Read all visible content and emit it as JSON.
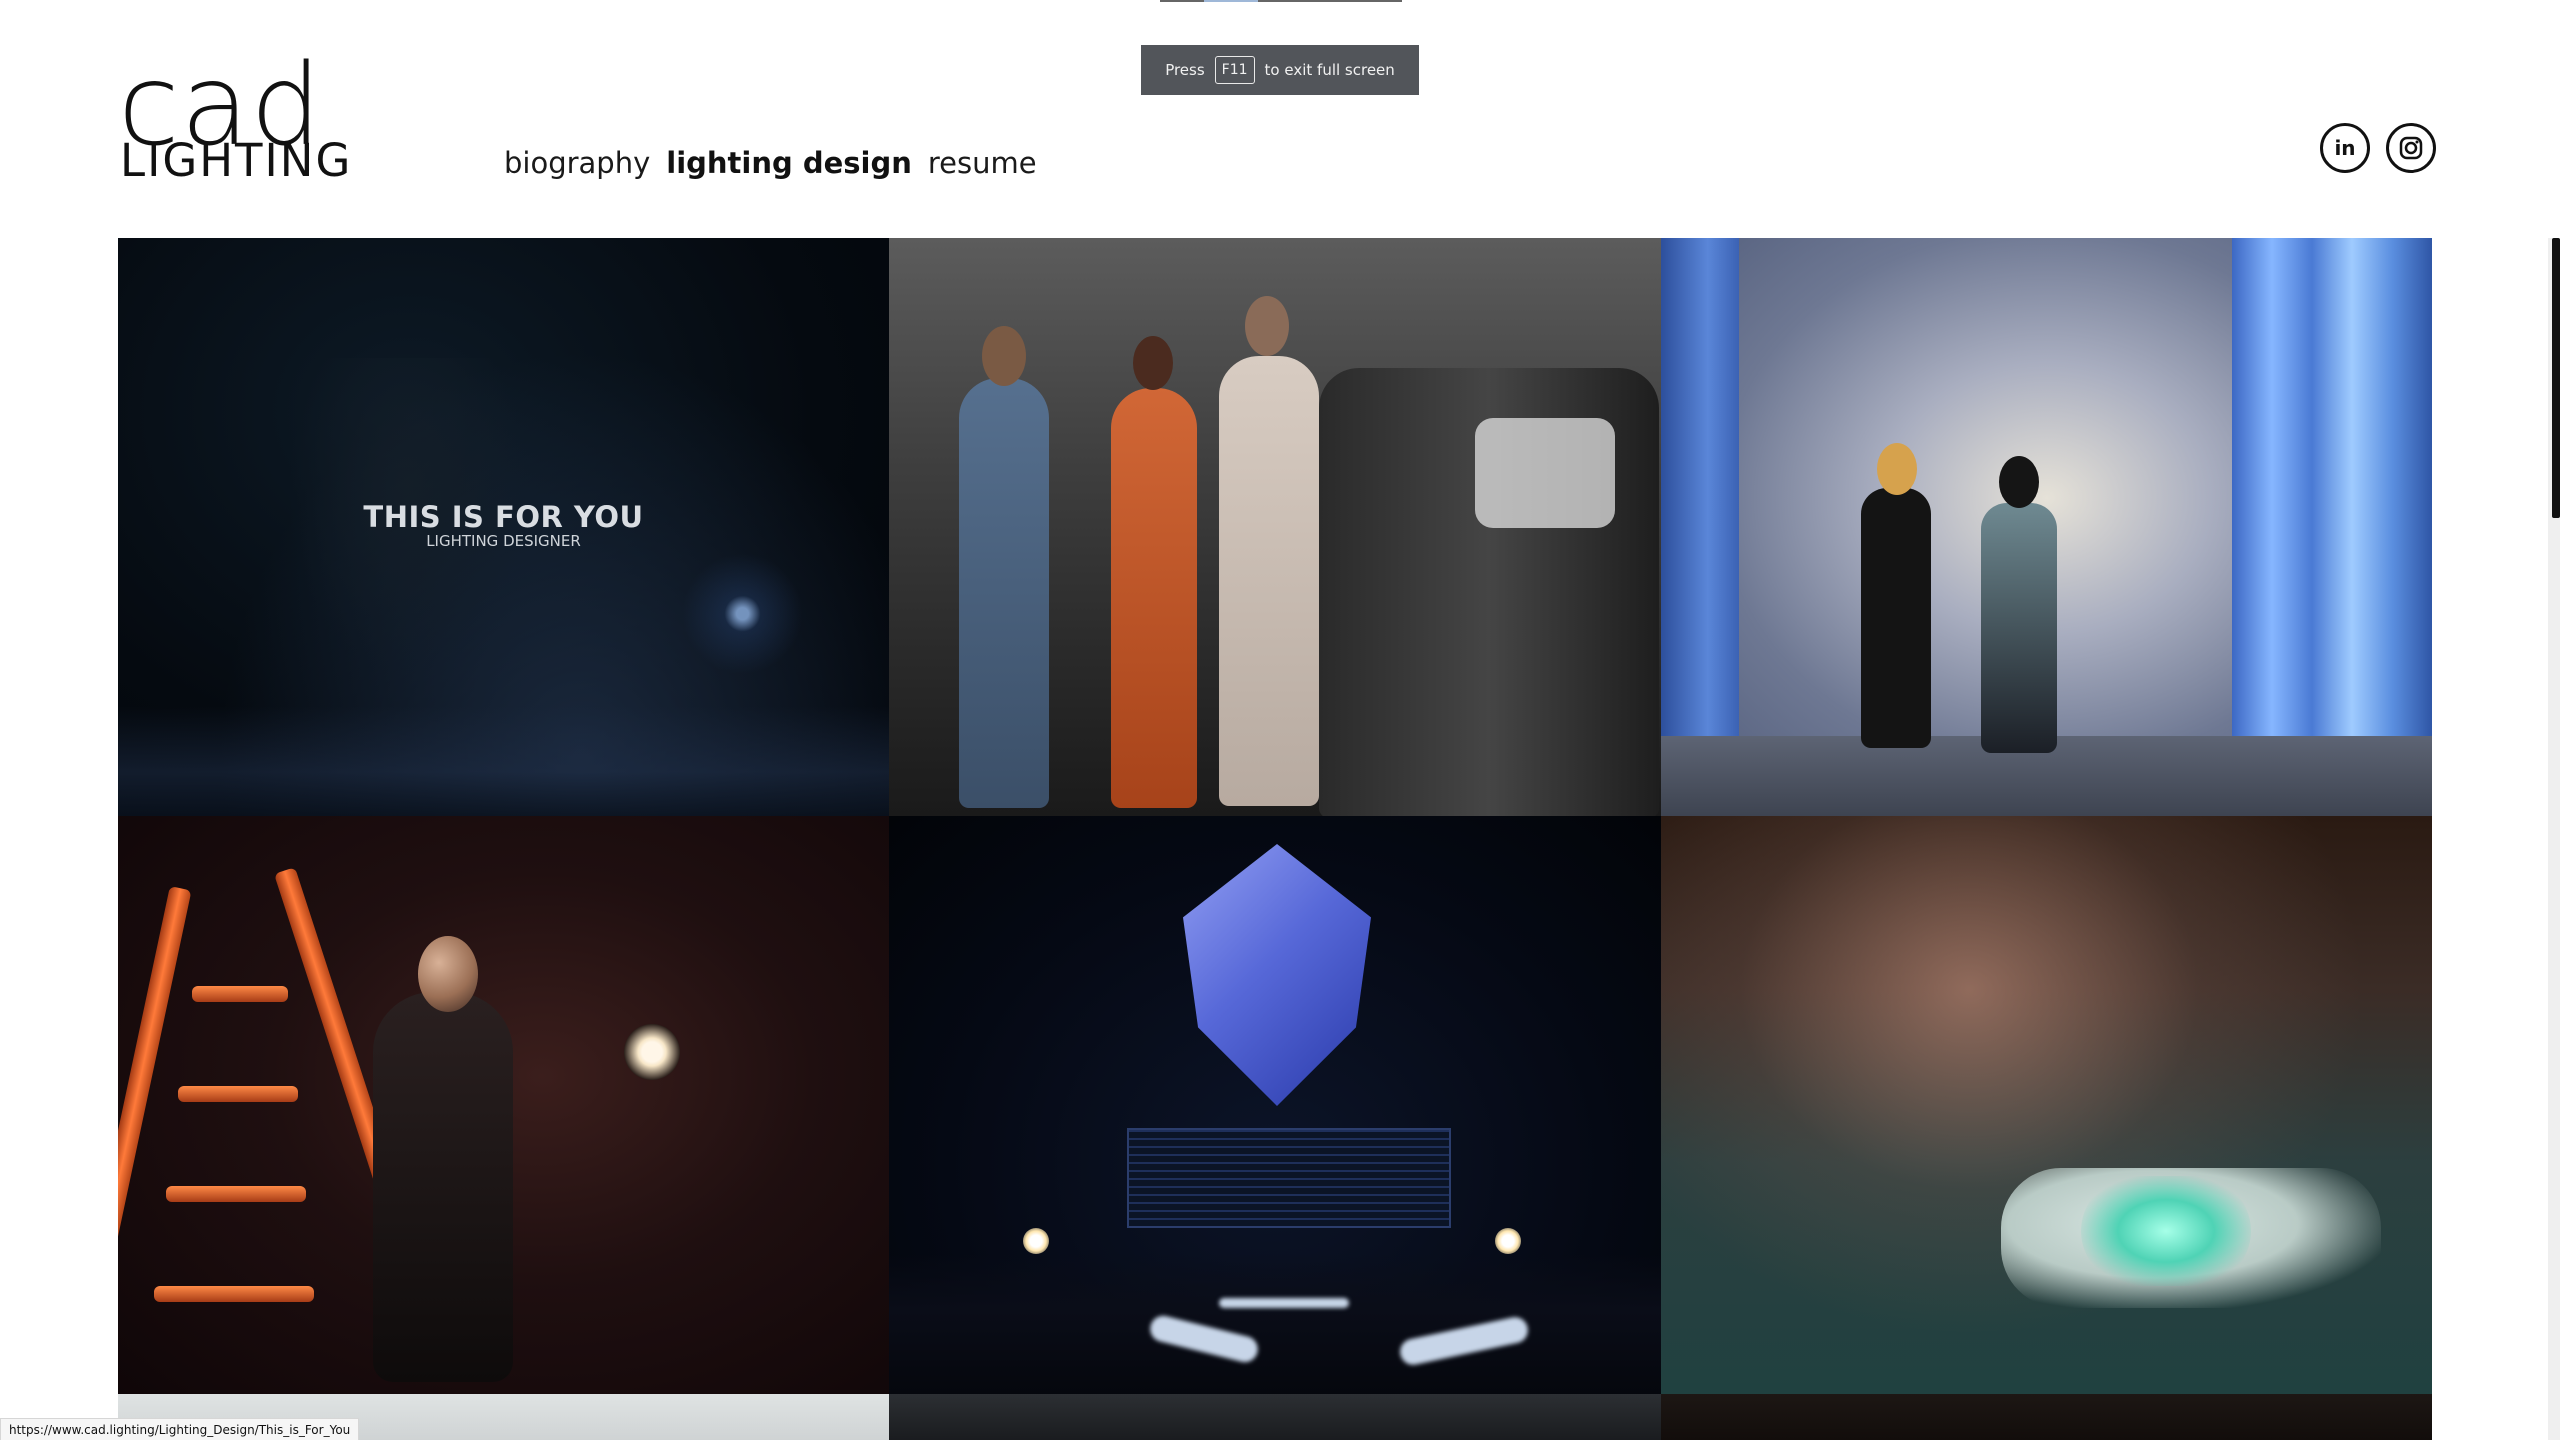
{
  "fullscreen_toast": {
    "prefix": "Press",
    "key": "F11",
    "suffix": "to exit full screen"
  },
  "logo": {
    "top": "cad",
    "bottom": "LIGHTING"
  },
  "nav": {
    "items": [
      {
        "label": "biography",
        "active": false
      },
      {
        "label": "lighting design",
        "active": true
      },
      {
        "label": "resume",
        "active": false
      }
    ]
  },
  "social": [
    {
      "name": "linkedin",
      "label": "in"
    },
    {
      "name": "instagram",
      "label": ""
    }
  ],
  "tiles": {
    "t1": {
      "title": "THIS IS FOR YOU",
      "subtitle": "LIGHTING DESIGNER"
    }
  },
  "status": {
    "url": "https://www.cad.lighting/Lighting_Design/This_is_For_You"
  },
  "colors": {
    "text": "#111111",
    "toast_bg": "#52555a"
  }
}
